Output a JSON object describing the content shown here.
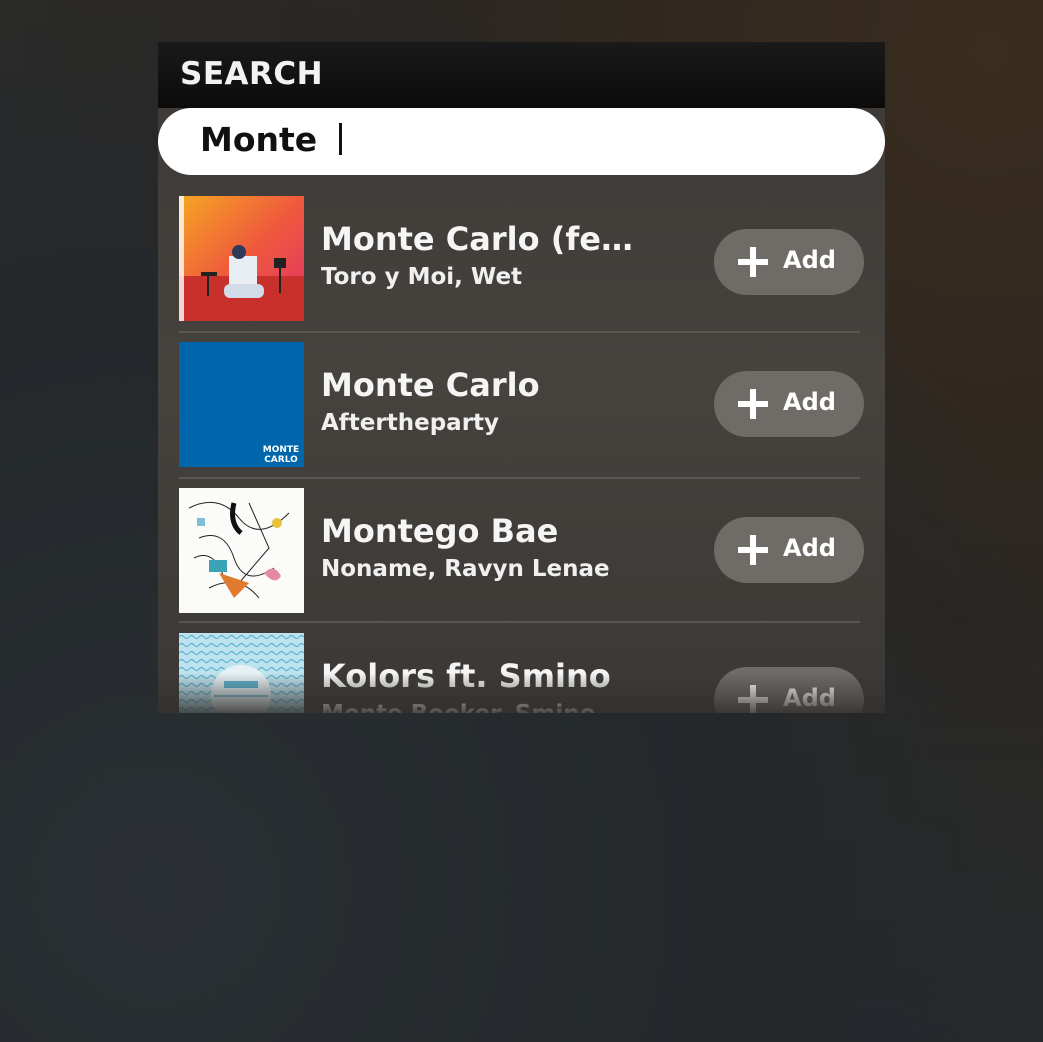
{
  "header": {
    "title": "SEARCH"
  },
  "search": {
    "query": "Monte "
  },
  "results": [
    {
      "title": "Monte Carlo (feat. ...",
      "artist": "Toro y Moi, Wet",
      "add_label": "Add",
      "art": "orange-pink-stage-cover"
    },
    {
      "title": "Monte Carlo",
      "artist": "Aftertheparty",
      "add_label": "Add",
      "art": "blue-square-cover",
      "art_text": [
        "MONTE",
        "CARLO"
      ]
    },
    {
      "title": "Montego Bae",
      "artist": "Noname, Ravyn Lenae",
      "add_label": "Add",
      "art": "line-drawing-cover"
    },
    {
      "title": "Kolors ft. Smino",
      "artist": "Monte Booker, Smino",
      "add_label": "Add",
      "art": "teal-pattern-cover"
    }
  ],
  "colors": {
    "button_bg": "#6f6b67",
    "panel_bg": "#46423e",
    "blue_cover": "#0066ab"
  },
  "icons": {
    "add": "plus-icon"
  }
}
